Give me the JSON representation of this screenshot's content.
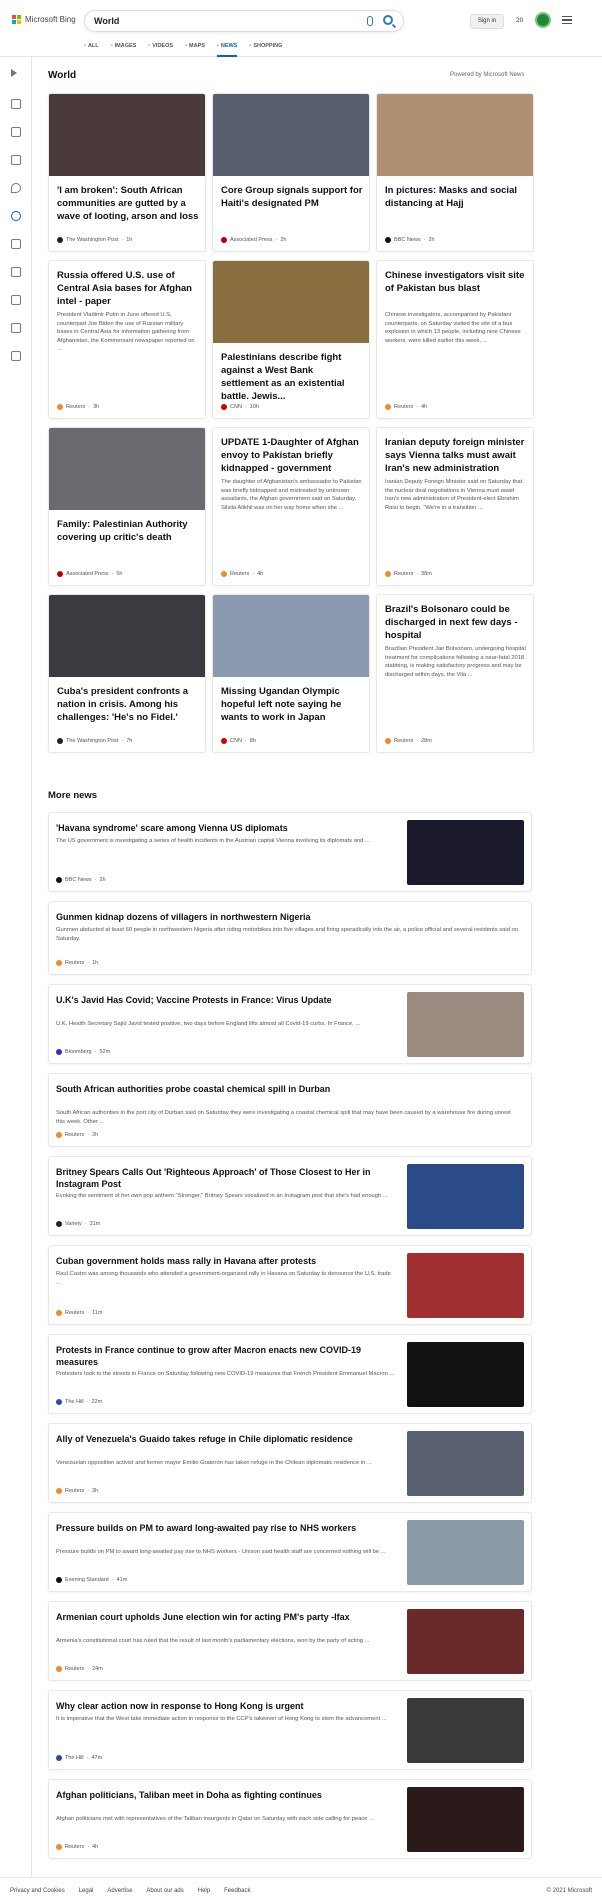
{
  "header": {
    "brand": "Microsoft Bing",
    "query": "World",
    "signin": "Sign in",
    "points": "20",
    "tabs": [
      {
        "label": "ALL",
        "icon": "search-icon"
      },
      {
        "label": "IMAGES",
        "icon": "image-icon"
      },
      {
        "label": "VIDEOS",
        "icon": "video-icon"
      },
      {
        "label": "MAPS",
        "icon": "map-icon"
      },
      {
        "label": "NEWS",
        "icon": "news-icon",
        "active": true
      },
      {
        "label": "SHOPPING",
        "icon": "shopping-icon"
      }
    ]
  },
  "section": {
    "title": "World",
    "powered": "Powered by Microsoft News"
  },
  "cards": [
    {
      "title": "'I am broken': South African communities are gutted by a wave of looting, arson and loss",
      "source": "The Washington Post",
      "age": "1h",
      "img": "#4a3a3a"
    },
    {
      "title": "Core Group signals support for Haiti's designated PM",
      "source": "Associated Press",
      "age": "2h",
      "img": "#5a5f70"
    },
    {
      "title": "In pictures: Masks and social distancing at Hajj",
      "source": "BBC News",
      "age": "2h",
      "img": "#b09070"
    },
    {
      "title": "Russia offered U.S. use of Central Asia bases for Afghan intel - paper",
      "desc": "President Vladimir Putin in June offered U.S. counterpart Joe Biden the use of Russian military bases in Central Asia for information gathering from Afghanistan, the Kommersant newspaper reported on ...",
      "source": "Reuters",
      "age": "3h"
    },
    {
      "title": "Palestinians describe fight against a West Bank settlement as an existential battle. Jewis...",
      "source": "CNN",
      "age": "10h",
      "img": "#8a7040"
    },
    {
      "title": "Chinese investigators visit site of Pakistan bus blast",
      "desc": "Chinese investigators, accompanied by Pakistani counterparts, on Saturday visited the site of a bus explosion in which 13 people, including nine Chinese workers, were killed earlier this week, ...",
      "source": "Reuters",
      "age": "4h"
    },
    {
      "title": "Family: Palestinian Authority covering up critic's death",
      "source": "Associated Press",
      "age": "5h",
      "img": "#6a6a70"
    },
    {
      "title": "UPDATE 1-Daughter of Afghan envoy to Pakistan briefly kidnapped - government",
      "desc": "The daughter of Afghanistan's ambassador to Pakistan was briefly kidnapped and mistreated by unknown assailants, the Afghan government said on Saturday. Silsila Alikhil was on her way home when she ...",
      "source": "Reuters",
      "age": "4h"
    },
    {
      "title": "Iranian deputy foreign minister says Vienna talks must await Iran's new administration",
      "desc": "Iranian Deputy Foreign Minister said on Saturday that the nuclear deal negotiations in Vienna must await Iran's new administration of President-elect Ebrahim Raisi to begin. \"We're in a transition ...",
      "source": "Reuters",
      "age": "38m"
    },
    {
      "title": "Cuba's president confronts a nation in crisis. Among his challenges: 'He's no Fidel.'",
      "source": "The Washington Post",
      "age": "7h",
      "img": "#3a3a40"
    },
    {
      "title": "Missing Ugandan Olympic hopeful left note saying he wants to work in Japan",
      "source": "CNN",
      "age": "8h",
      "img": "#8a9ab0"
    },
    {
      "title": "Brazil's Bolsonaro could be discharged in next few days - hospital",
      "desc": "Brazilian President Jair Bolsonaro, undergoing hospital treatment for complications following a near-fatal 2018 stabbing, is making satisfactory progress and may be discharged within days, the Vila ...",
      "source": "Reuters",
      "age": "28m"
    }
  ],
  "more": {
    "title": "More news",
    "items": [
      {
        "title": "'Havana syndrome' scare among Vienna US diplomats",
        "desc": "The US government is investigating a series of health incidents in the Austrian capital Vienna involving its diplomats and ...",
        "source": "BBC News",
        "age": "2h",
        "img": "#1a1a2a"
      },
      {
        "title": "Gunmen kidnap dozens of villagers in northwestern Nigeria",
        "desc": "Gunmen abducted at least 60 people in northwestern Nigeria after riding motorbikes into five villages and firing sporadically into the air, a police official and several residents said on Saturday.",
        "source": "Reuters",
        "age": "1h"
      },
      {
        "title": "U.K's Javid Has Covid; Vaccine Protests in France: Virus Update",
        "desc": "U.K. Health Secretary Sajid Javid tested positive, two days before England lifts almost all Covid-19 curbs. In France, ...",
        "source": "Bloomberg",
        "age": "52m",
        "img": "#9a8a80"
      },
      {
        "title": "South African authorities probe coastal chemical spill in Durban",
        "desc": "South African authorities in the port city of Durban said on Saturday they were investigating a coastal chemical spill that may have been caused by a warehouse fire during unrest this week. Other ...",
        "source": "Reuters",
        "age": "2h"
      },
      {
        "title": "Britney Spears Calls Out 'Righteous Approach' of Those Closest to Her in Instagram Post",
        "desc": "Evoking the sentiment of her own pop anthem \"Stronger,\" Britney Spears vocalized in an Instagram post that she's had enough ...",
        "source": "Variety",
        "age": "31m",
        "img": "#2a4a8a"
      },
      {
        "title": "Cuban government holds mass rally in Havana after protests",
        "desc": "Raul Castro was among thousands who attended a government-organized rally in Havana on Saturday to denounce the U.S. trade ...",
        "source": "Reuters",
        "age": "11m",
        "img": "#a03030"
      },
      {
        "title": "Protests in France continue to grow after Macron enacts new COVID-19 measures",
        "desc": "Protesters took to the streets in France on Saturday following new COVID-19 measures that French President Emmanuel Macron ...",
        "source": "The Hill",
        "age": "22m",
        "img": "#111111"
      },
      {
        "title": "Ally of Venezuela's Guaido takes refuge in Chile diplomatic residence",
        "desc": "Venezuelan opposition activist and former mayor Emilio Graterón has taken refuge in the Chilean diplomatic residence in ...",
        "source": "Reuters",
        "age": "3h",
        "img": "#5a6070"
      },
      {
        "title": "Pressure builds on PM to award long-awaited pay rise to NHS workers",
        "desc": "Pressure builds on PM to award long-awaited pay rise to NHS workers - Unison said health staff are concerned nothing will be ...",
        "source": "Evening Standard",
        "age": "41m",
        "img": "#8a9aa8"
      },
      {
        "title": "Armenian court upholds June election win for acting PM's party -Ifax",
        "desc": "Armenia's constitutional court has ruled that the result of last month's parliamentary elections, won by the party of acting ...",
        "source": "Reuters",
        "age": "24m",
        "img": "#6a2a2a"
      },
      {
        "title": "Why clear action now in response to Hong Kong is urgent",
        "desc": "It is imperative that the West take immediate action in response to the CCP's takeover of Hong Kong to stem the advancement ...",
        "source": "The Hill",
        "age": "47m",
        "img": "#3a3a3a"
      },
      {
        "title": "Afghan politicians, Taliban meet in Doha as fighting continues",
        "desc": "Afghan politicians met with representatives of the Taliban insurgents in Qatar on Saturday with each side calling for peace ...",
        "source": "Reuters",
        "age": "4h",
        "img": "#2a1a1a"
      }
    ]
  },
  "footer": {
    "links": [
      "Privacy and Cookies",
      "Legal",
      "Advertise",
      "About our ads",
      "Help",
      "Feedback"
    ],
    "copyright": "© 2021 Microsoft"
  },
  "source_colors": {
    "Reuters": "#f08a2a",
    "The Washington Post": "#222222",
    "Associated Press": "#c00000",
    "BBC News": "#111111",
    "CNN": "#cc0000",
    "Bloomberg": "#3a2ad0",
    "Variety": "#222222",
    "The Hill": "#2a4ab0",
    "Evening Standard": "#111111"
  }
}
